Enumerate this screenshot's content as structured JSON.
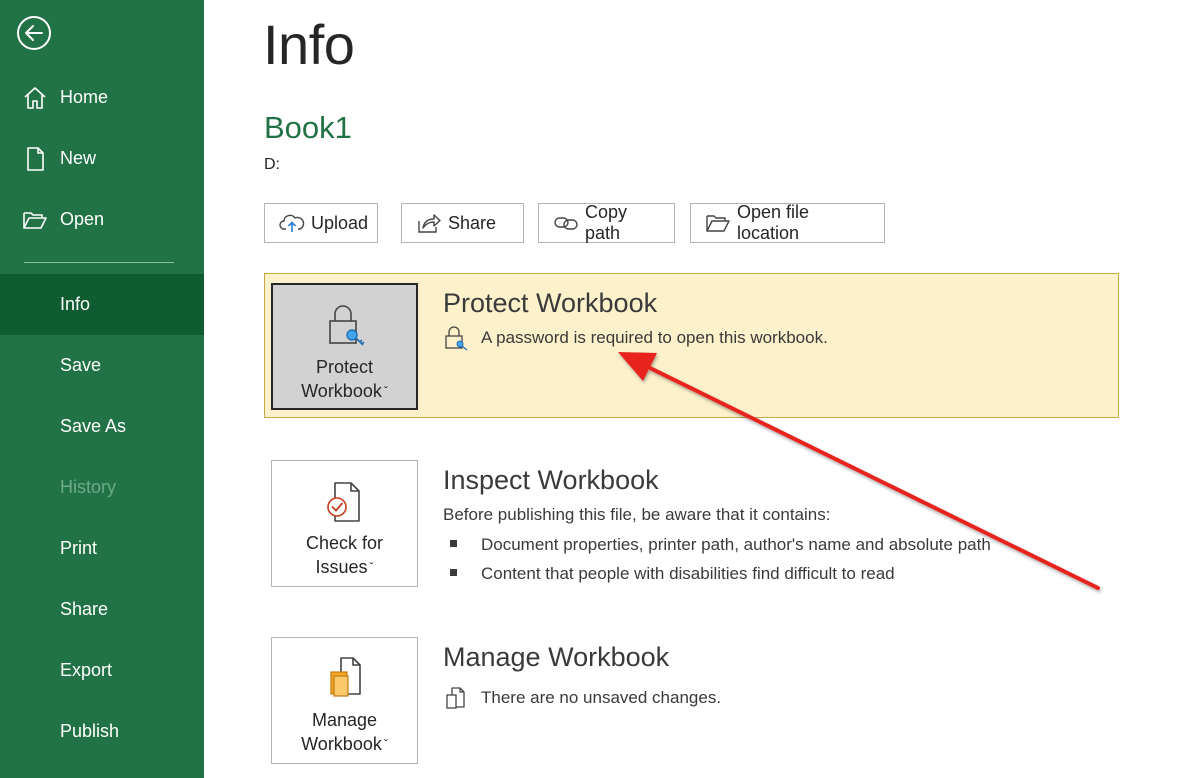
{
  "sidebar": {
    "items": [
      {
        "label": "Home"
      },
      {
        "label": "New"
      },
      {
        "label": "Open"
      },
      {
        "label": "Info"
      },
      {
        "label": "Save"
      },
      {
        "label": "Save As"
      },
      {
        "label": "History"
      },
      {
        "label": "Print"
      },
      {
        "label": "Share"
      },
      {
        "label": "Export"
      },
      {
        "label": "Publish"
      }
    ],
    "active": "Info",
    "disabled": [
      "History"
    ]
  },
  "page": {
    "title": "Info",
    "doc_name": "Book1",
    "doc_path": "D:"
  },
  "actions": [
    {
      "label": "Upload",
      "icon": "cloud-upload-icon"
    },
    {
      "label": "Share",
      "icon": "share-icon"
    },
    {
      "label": "Copy path",
      "icon": "link-icon"
    },
    {
      "label": "Open file location",
      "icon": "folder-icon"
    }
  ],
  "protect": {
    "tile_line1": "Protect",
    "tile_line2": "Workbook",
    "title": "Protect Workbook",
    "status": "A password is required to open this workbook."
  },
  "inspect": {
    "tile_line1": "Check for",
    "tile_line2": "Issues",
    "title": "Inspect Workbook",
    "intro": "Before publishing this file, be aware that it contains:",
    "bullets": [
      "Document properties, printer path, author's name and absolute path",
      "Content that people with disabilities find difficult to read"
    ]
  },
  "manage": {
    "tile_line1": "Manage",
    "tile_line2": "Workbook",
    "title": "Manage Workbook",
    "status": "There are no unsaved changes."
  },
  "colors": {
    "sidebar": "#217346",
    "sidebar_active": "#0e5c2f",
    "accent_text": "#217346",
    "highlight_band": "#fdf1cb",
    "annotation": "#e8201c"
  }
}
